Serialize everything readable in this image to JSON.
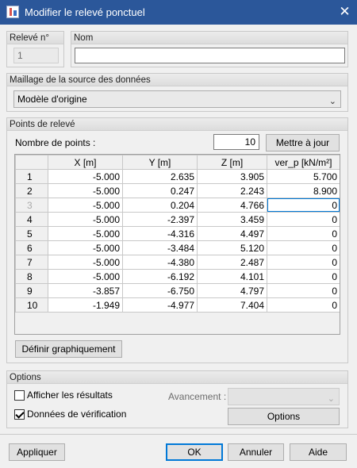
{
  "window": {
    "title": "Modifier le relevé ponctuel"
  },
  "ident": {
    "num_label": "Relevé n°",
    "num_value": "1",
    "name_label": "Nom",
    "name_value": ""
  },
  "mesh": {
    "label": "Maillage de la source des données",
    "selected": "Modèle d'origine"
  },
  "points": {
    "label": "Points de relevé",
    "count_label": "Nombre de points :",
    "count_value": "10",
    "update_button": "Mettre à jour",
    "define_button": "Définir graphiquement",
    "columns": [
      "",
      "X [m]",
      "Y [m]",
      "Z [m]",
      "ver_p [kN/m²]"
    ],
    "rows": [
      [
        "1",
        "-5.000",
        "2.635",
        "3.905",
        "5.700"
      ],
      [
        "2",
        "-5.000",
        "0.247",
        "2.243",
        "8.900"
      ],
      [
        "3",
        "-5.000",
        "0.204",
        "4.766",
        "0"
      ],
      [
        "4",
        "-5.000",
        "-2.397",
        "3.459",
        "0"
      ],
      [
        "5",
        "-5.000",
        "-4.316",
        "4.497",
        "0"
      ],
      [
        "6",
        "-5.000",
        "-3.484",
        "5.120",
        "0"
      ],
      [
        "7",
        "-5.000",
        "-4.380",
        "2.487",
        "0"
      ],
      [
        "8",
        "-5.000",
        "-6.192",
        "4.101",
        "0"
      ],
      [
        "9",
        "-3.857",
        "-6.750",
        "4.797",
        "0"
      ],
      [
        "10",
        "-1.949",
        "-4.977",
        "7.404",
        "0"
      ]
    ]
  },
  "options": {
    "label": "Options",
    "show_results": "Afficher les résultats",
    "show_results_checked": false,
    "verify_data": "Données de vérification",
    "verify_data_checked": true,
    "progress_label": "Avancement :",
    "progress_value": "",
    "options_button": "Options"
  },
  "footer": {
    "apply": "Appliquer",
    "ok": "OK",
    "cancel": "Annuler",
    "help": "Aide"
  },
  "icons": {
    "window": "app-icon",
    "close": "close-icon",
    "combo": "chevron-down-icon"
  }
}
